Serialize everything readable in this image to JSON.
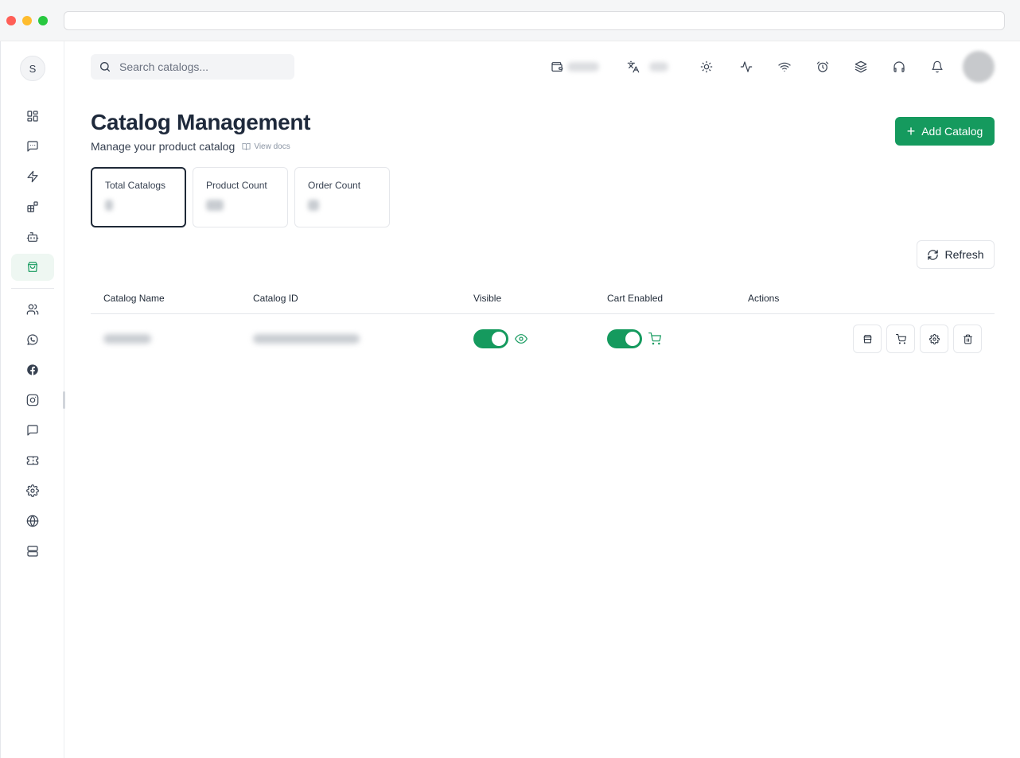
{
  "search": {
    "placeholder": "Search catalogs..."
  },
  "sidebar": {
    "avatar_initial": "S",
    "items": [
      {
        "name": "dashboard",
        "icon": "grid-icon"
      },
      {
        "name": "messages",
        "icon": "message-square-icon"
      },
      {
        "name": "automation",
        "icon": "zap-icon"
      },
      {
        "name": "integrations",
        "icon": "blocks-icon"
      },
      {
        "name": "bots",
        "icon": "bot-icon"
      },
      {
        "name": "catalog",
        "icon": "shopping-bag-icon",
        "active": true
      },
      {
        "name": "contacts",
        "icon": "users-icon"
      },
      {
        "name": "whatsapp",
        "icon": "whatsapp-icon"
      },
      {
        "name": "facebook",
        "icon": "facebook-icon"
      },
      {
        "name": "instagram",
        "icon": "instagram-icon"
      },
      {
        "name": "chat",
        "icon": "message-circle-icon"
      },
      {
        "name": "tickets",
        "icon": "ticket-icon"
      },
      {
        "name": "settings",
        "icon": "gear-icon"
      },
      {
        "name": "web",
        "icon": "globe-icon"
      },
      {
        "name": "servers",
        "icon": "server-icon"
      }
    ]
  },
  "topbar": {
    "icons": [
      "wallet-icon",
      "language-icon",
      "sun-icon",
      "activity-icon",
      "wifi-icon",
      "alarm-clock-icon",
      "layers-icon",
      "headphones-icon",
      "bell-icon"
    ]
  },
  "header": {
    "title": "Catalog Management",
    "subtitle": "Manage your product catalog",
    "docs_link": "View docs",
    "add_button": "Add Catalog"
  },
  "stats": [
    {
      "label": "Total Catalogs",
      "active": true
    },
    {
      "label": "Product Count"
    },
    {
      "label": "Order Count"
    }
  ],
  "refresh_button": "Refresh",
  "table": {
    "columns": [
      "Catalog Name",
      "Catalog ID",
      "Visible",
      "Cart Enabled",
      "Actions"
    ],
    "rows": [
      {
        "visible": true,
        "cart_enabled": true
      }
    ]
  },
  "colors": {
    "accent": "#159a5e",
    "title": "#1e293b"
  }
}
